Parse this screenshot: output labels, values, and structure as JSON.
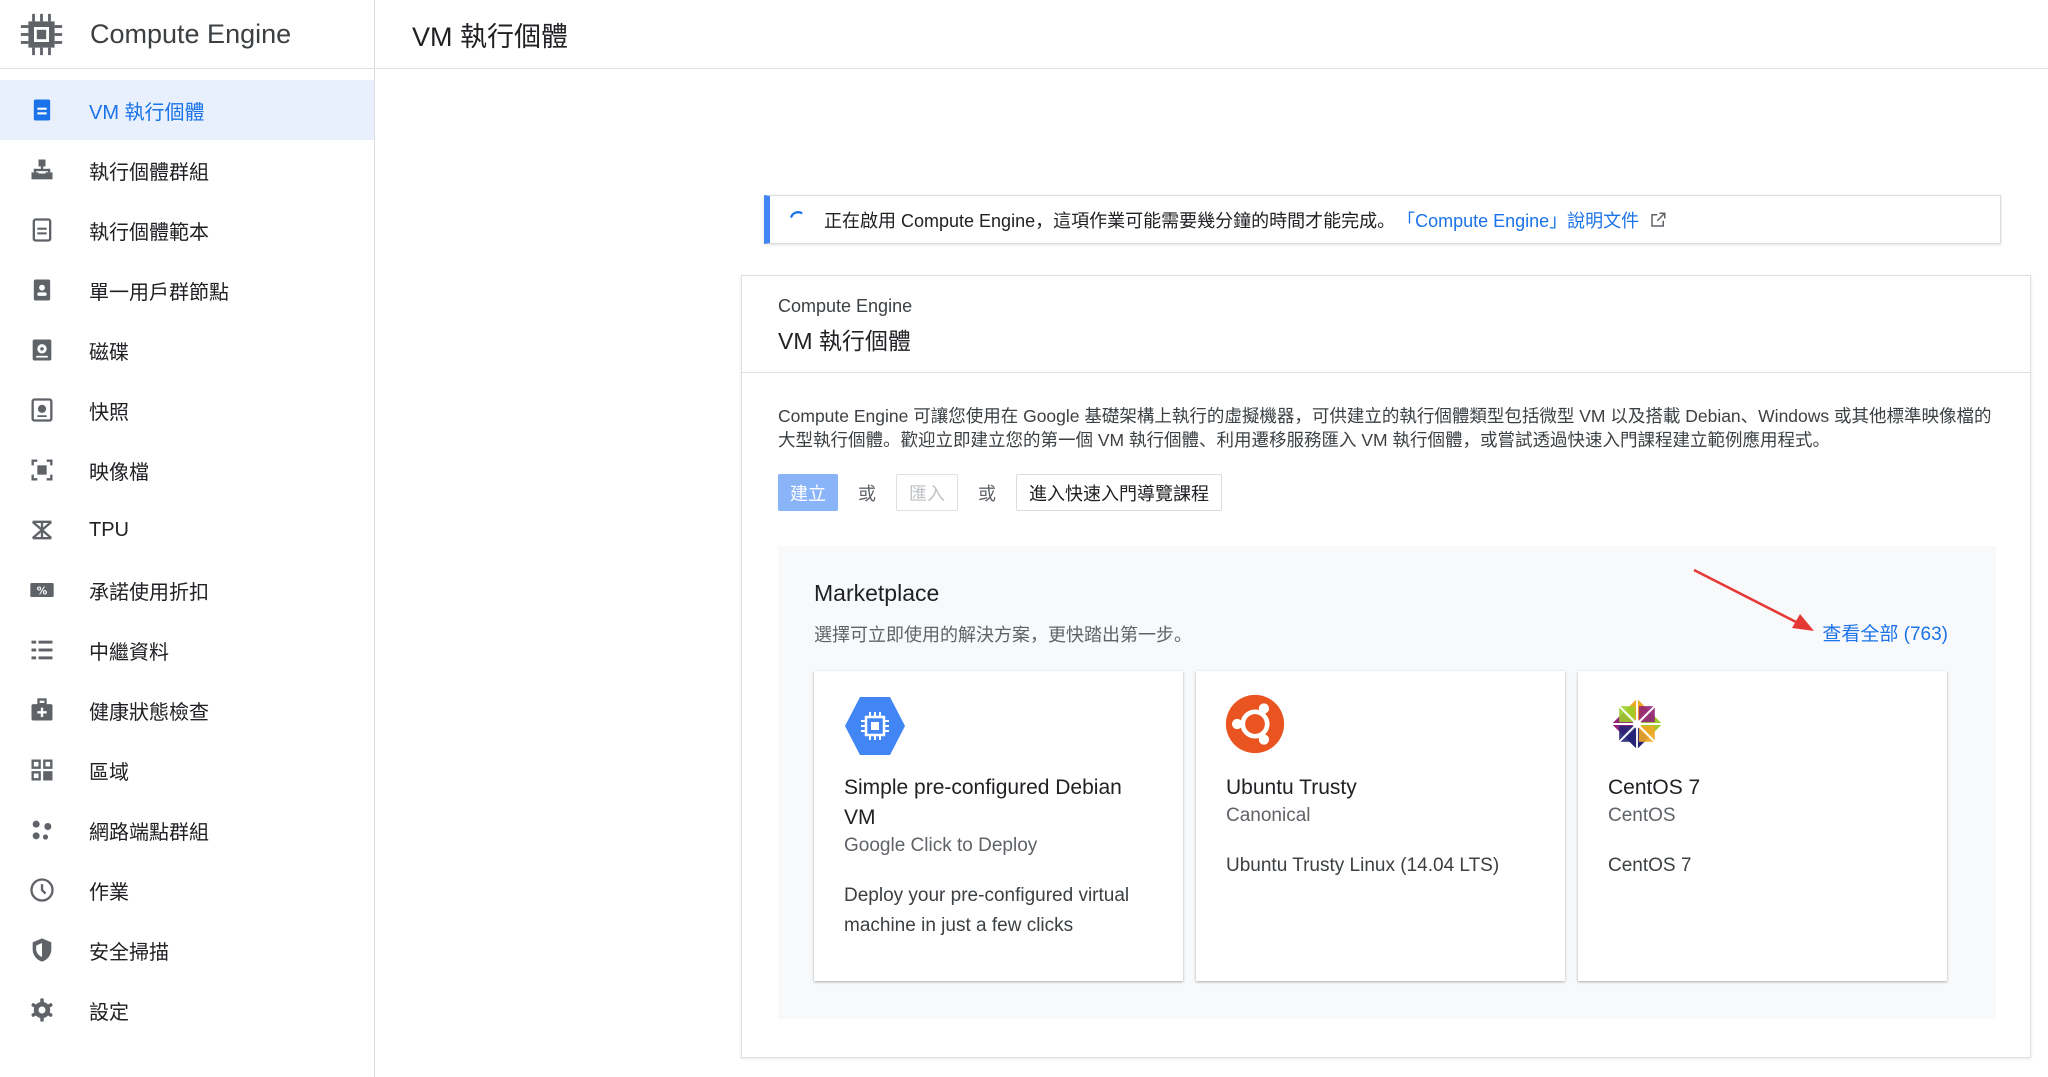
{
  "sidebar": {
    "product_name": "Compute Engine",
    "items": [
      {
        "label": "VM 執行個體",
        "icon": "vm-instances-icon",
        "active": true
      },
      {
        "label": "執行個體群組",
        "icon": "instance-groups-icon"
      },
      {
        "label": "執行個體範本",
        "icon": "instance-templates-icon"
      },
      {
        "label": "單一用戶群節點",
        "icon": "sole-tenant-nodes-icon"
      },
      {
        "label": "磁碟",
        "icon": "disks-icon"
      },
      {
        "label": "快照",
        "icon": "snapshots-icon"
      },
      {
        "label": "映像檔",
        "icon": "images-icon"
      },
      {
        "label": "TPU",
        "icon": "tpu-icon"
      },
      {
        "label": "承諾使用折扣",
        "icon": "committed-use-discount-icon"
      },
      {
        "label": "中繼資料",
        "icon": "metadata-icon"
      },
      {
        "label": "健康狀態檢查",
        "icon": "health-checks-icon"
      },
      {
        "label": "區域",
        "icon": "zones-icon"
      },
      {
        "label": "網路端點群組",
        "icon": "network-endpoint-groups-icon"
      },
      {
        "label": "作業",
        "icon": "operations-icon"
      },
      {
        "label": "安全掃描",
        "icon": "security-scan-icon"
      },
      {
        "label": "設定",
        "icon": "settings-icon"
      }
    ]
  },
  "header": {
    "title": "VM 執行個體"
  },
  "banner": {
    "message": "正在啟用 Compute Engine，這項作業可能需要幾分鐘的時間才能完成。",
    "link_text": "「Compute Engine」說明文件"
  },
  "card": {
    "overline": "Compute Engine",
    "title": "VM 執行個體",
    "description": "Compute Engine 可讓您使用在 Google 基礎架構上執行的虛擬機器，可供建立的執行個體類型包括微型 VM 以及搭載 Debian、Windows 或其他標準映像檔的大型執行個體。歡迎立即建立您的第一個 VM 執行個體、利用遷移服務匯入 VM 執行個體，或嘗試透過快速入門課程建立範例應用程式。",
    "actions": {
      "create_label": "建立",
      "or_label": "或",
      "import_label": "匯入",
      "quickstart_label": "進入快速入門導覽課程"
    }
  },
  "marketplace": {
    "title": "Marketplace",
    "subtitle": "選擇可立即使用的解決方案，更快踏出第一步。",
    "view_all": "查看全部 (763)",
    "cards": [
      {
        "name": "Simple pre-configured Debian VM",
        "vendor": "Google Click to Deploy",
        "description": "Deploy your pre-configured virtual machine in just a few clicks",
        "logo": "gcp-compute-logo"
      },
      {
        "name": "Ubuntu Trusty",
        "vendor": "Canonical",
        "description": "Ubuntu Trusty Linux (14.04 LTS)",
        "logo": "ubuntu-logo"
      },
      {
        "name": "CentOS 7",
        "vendor": "CentOS",
        "description": "CentOS 7",
        "logo": "centos-logo"
      }
    ]
  },
  "colors": {
    "accent": "#1a73e8",
    "banner_stripe": "#4285f4",
    "active_bg": "#e8f0fe",
    "annotation_arrow": "#e53935"
  }
}
